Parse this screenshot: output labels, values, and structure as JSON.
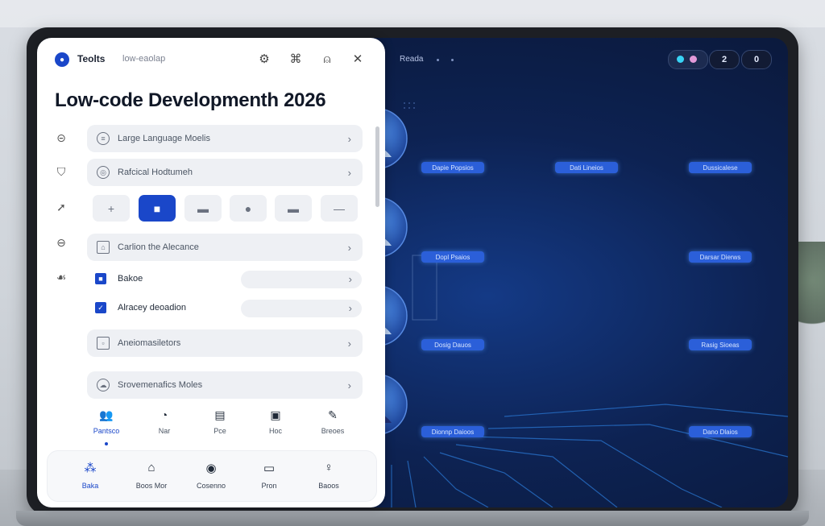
{
  "panel": {
    "app_logo": "●",
    "app_name": "Teolts",
    "breadcrumb": "low-eaolap",
    "title": "Low-code Developmenth 2026",
    "rows": [
      {
        "label": "Large Language Moelis"
      },
      {
        "label": "Rafcical Hodtumeh"
      },
      {
        "label": "Carlion the Alecance"
      },
      {
        "label": "Aneiomasiletors"
      },
      {
        "label": "Srovemenafics Moles"
      }
    ],
    "toolbar_buttons": [
      "+",
      "■",
      "▬",
      "●",
      "▬",
      "—"
    ],
    "checks": [
      {
        "label": "Bakoe"
      },
      {
        "label": "Alracey deoadion"
      }
    ],
    "tabs": [
      {
        "label": "Pantsco",
        "icon": "people-icon"
      },
      {
        "label": "Nar",
        "icon": "clock-icon"
      },
      {
        "label": "Pce",
        "icon": "document-icon"
      },
      {
        "label": "Hoc",
        "icon": "file-icon"
      },
      {
        "label": "Breoes",
        "icon": "edit-icon"
      }
    ],
    "bottom_nav": [
      {
        "label": "Baka",
        "icon": "grid-icon"
      },
      {
        "label": "Boos Mor",
        "icon": "home-icon"
      },
      {
        "label": "Cosenno",
        "icon": "badge-icon"
      },
      {
        "label": "Pron",
        "icon": "monitor-icon"
      },
      {
        "label": "Baoos",
        "icon": "user-icon"
      }
    ]
  },
  "visual": {
    "title": "Reada",
    "controls": [
      "2",
      "0"
    ],
    "nodes": [
      {
        "label": "Dapie Popsios"
      },
      {
        "label": "Dati Lineios"
      },
      {
        "label": "Dussicalese"
      },
      {
        "label": "Dopl Psaios"
      },
      {
        "label": "Darsar Dierws"
      },
      {
        "label": "Dosig Dauos"
      },
      {
        "label": "Rasig Sioeas"
      },
      {
        "label": "Dionnp Daioos"
      },
      {
        "label": "Dano Dlaios"
      }
    ],
    "colors": {
      "accent": "#1a47c9",
      "glow": "#38d3f5",
      "node": "#2b5fd9"
    }
  }
}
